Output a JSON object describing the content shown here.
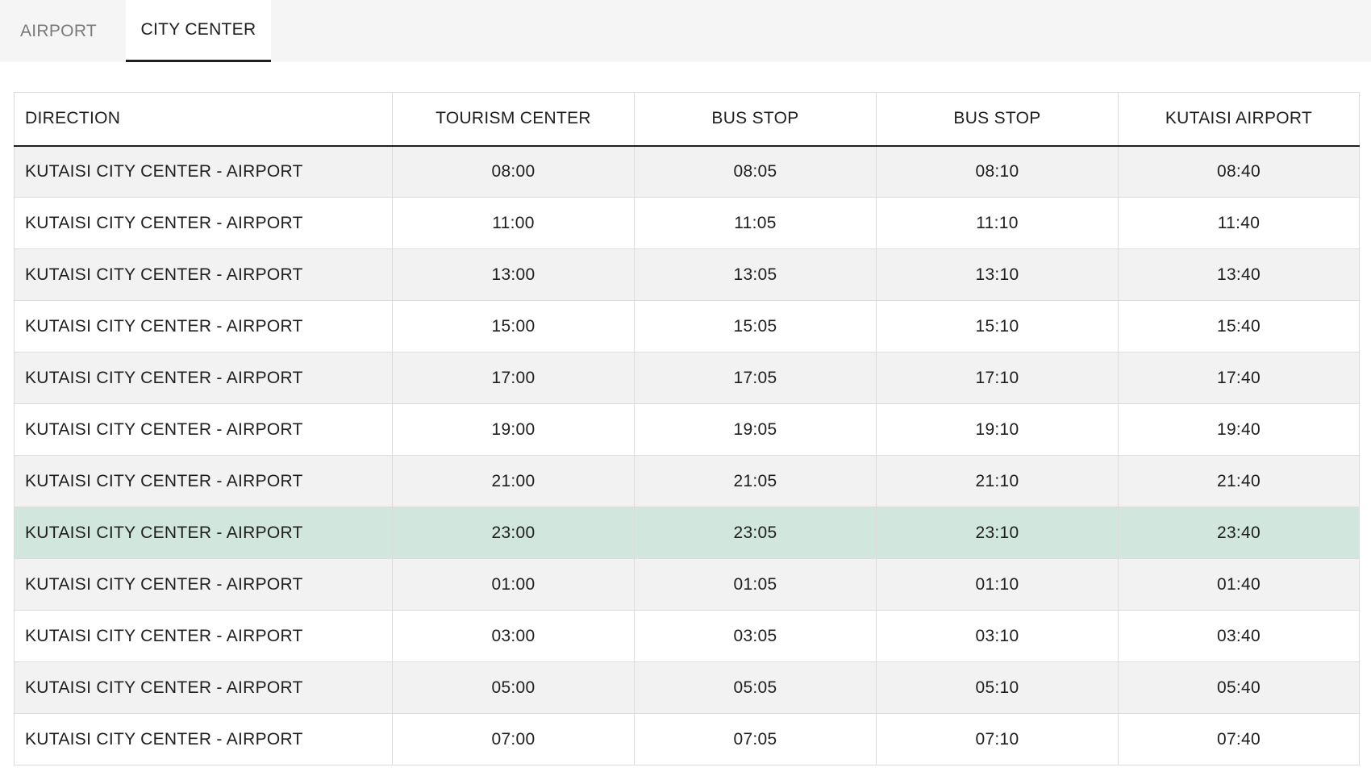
{
  "tabs": [
    {
      "label": "AIRPORT",
      "active": false
    },
    {
      "label": "CITY CENTER",
      "active": true
    }
  ],
  "table": {
    "headers": [
      "DIRECTION",
      "TOURISM CENTER",
      "BUS STOP",
      "BUS STOP",
      "KUTAISI AIRPORT"
    ],
    "rows": [
      [
        "KUTAISI CITY CENTER - AIRPORT",
        "08:00",
        "08:05",
        "08:10",
        "08:40"
      ],
      [
        "KUTAISI CITY CENTER - AIRPORT",
        "11:00",
        "11:05",
        "11:10",
        "11:40"
      ],
      [
        "KUTAISI CITY CENTER - AIRPORT",
        "13:00",
        "13:05",
        "13:10",
        "13:40"
      ],
      [
        "KUTAISI CITY CENTER - AIRPORT",
        "15:00",
        "15:05",
        "15:10",
        "15:40"
      ],
      [
        "KUTAISI CITY CENTER - AIRPORT",
        "17:00",
        "17:05",
        "17:10",
        "17:40"
      ],
      [
        "KUTAISI CITY CENTER - AIRPORT",
        "19:00",
        "19:05",
        "19:10",
        "19:40"
      ],
      [
        "KUTAISI CITY CENTER - AIRPORT",
        "21:00",
        "21:05",
        "21:10",
        "21:40"
      ],
      [
        "KUTAISI CITY CENTER - AIRPORT",
        "23:00",
        "23:05",
        "23:10",
        "23:40"
      ],
      [
        "KUTAISI CITY CENTER - AIRPORT",
        "01:00",
        "01:05",
        "01:10",
        "01:40"
      ],
      [
        "KUTAISI CITY CENTER - AIRPORT",
        "03:00",
        "03:05",
        "03:10",
        "03:40"
      ],
      [
        "KUTAISI CITY CENTER - AIRPORT",
        "05:00",
        "05:05",
        "05:10",
        "05:40"
      ],
      [
        "KUTAISI CITY CENTER - AIRPORT",
        "07:00",
        "07:05",
        "07:10",
        "07:40"
      ]
    ],
    "highlighted_row_index": 7
  },
  "colors": {
    "highlight": "#d1e6dd",
    "stripe": "#f2f2f2",
    "active_tab_underline": "#1e1e1e"
  }
}
